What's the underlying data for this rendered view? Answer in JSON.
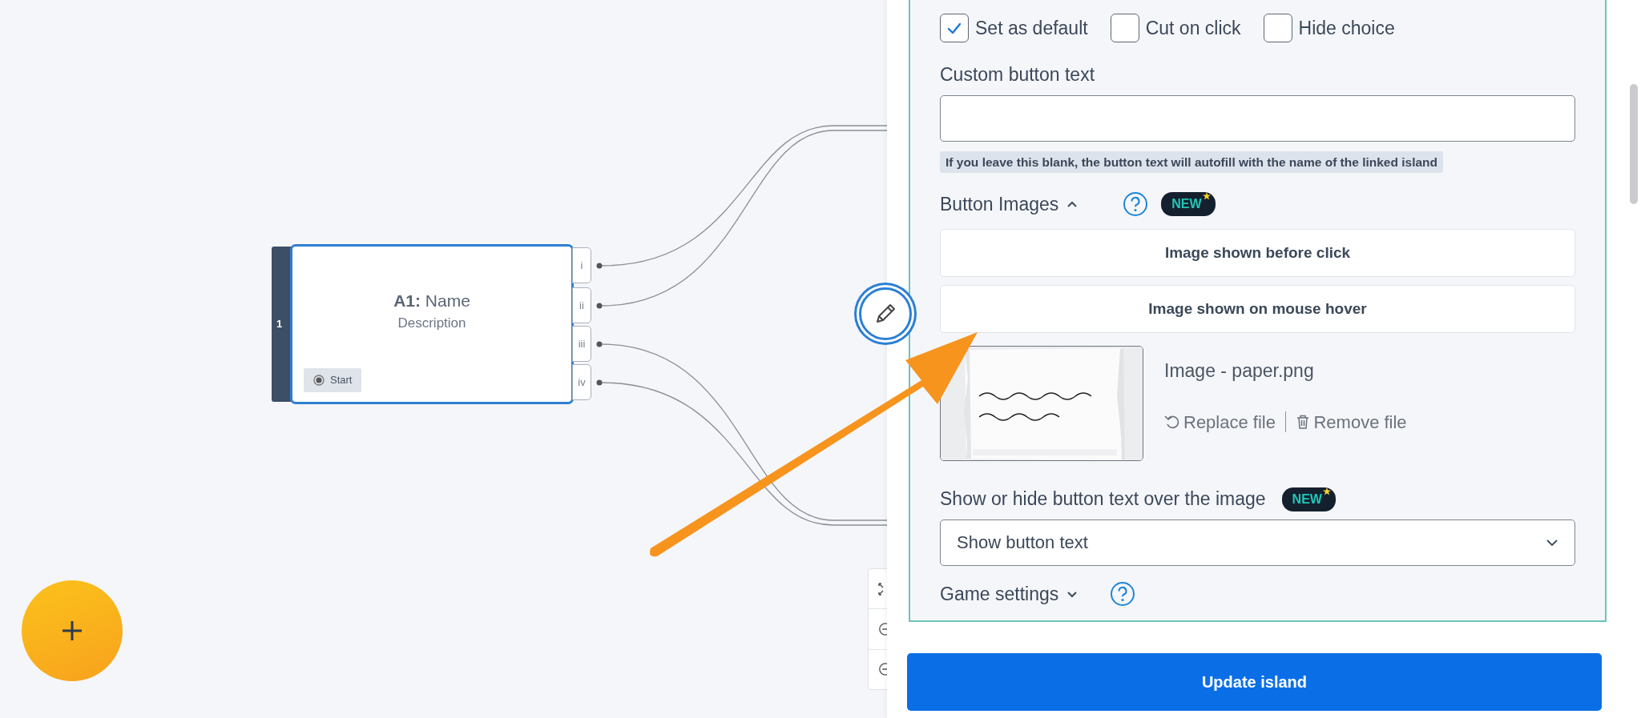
{
  "canvas": {
    "node": {
      "number": "1",
      "title": "**A1:** Name",
      "description": "Description",
      "start_label": "Start",
      "outputs": [
        "i",
        "ii",
        "iii",
        "iv"
      ]
    }
  },
  "panel": {
    "options": [
      {
        "label": "Set as default",
        "checked": true
      },
      {
        "label": "Cut on click",
        "checked": false
      },
      {
        "label": "Hide choice",
        "checked": false
      }
    ],
    "custom_text": {
      "label": "Custom button text",
      "hint": "If you leave this blank, the button text will autofill with the name of the linked island"
    },
    "button_images": {
      "label": "Button Images",
      "expanded": true,
      "badge": "NEW",
      "buttons": [
        "Image shown before click",
        "Image shown on mouse hover"
      ],
      "file": {
        "name": "Image - paper.png",
        "actions": [
          "Replace file",
          "Remove file"
        ]
      }
    },
    "text_visibility": {
      "label": "Show or hide button text over the image",
      "badge": "NEW",
      "value": "Show button text"
    },
    "game_settings": {
      "label": "Game settings",
      "expanded": false
    },
    "submit": "Update island"
  }
}
